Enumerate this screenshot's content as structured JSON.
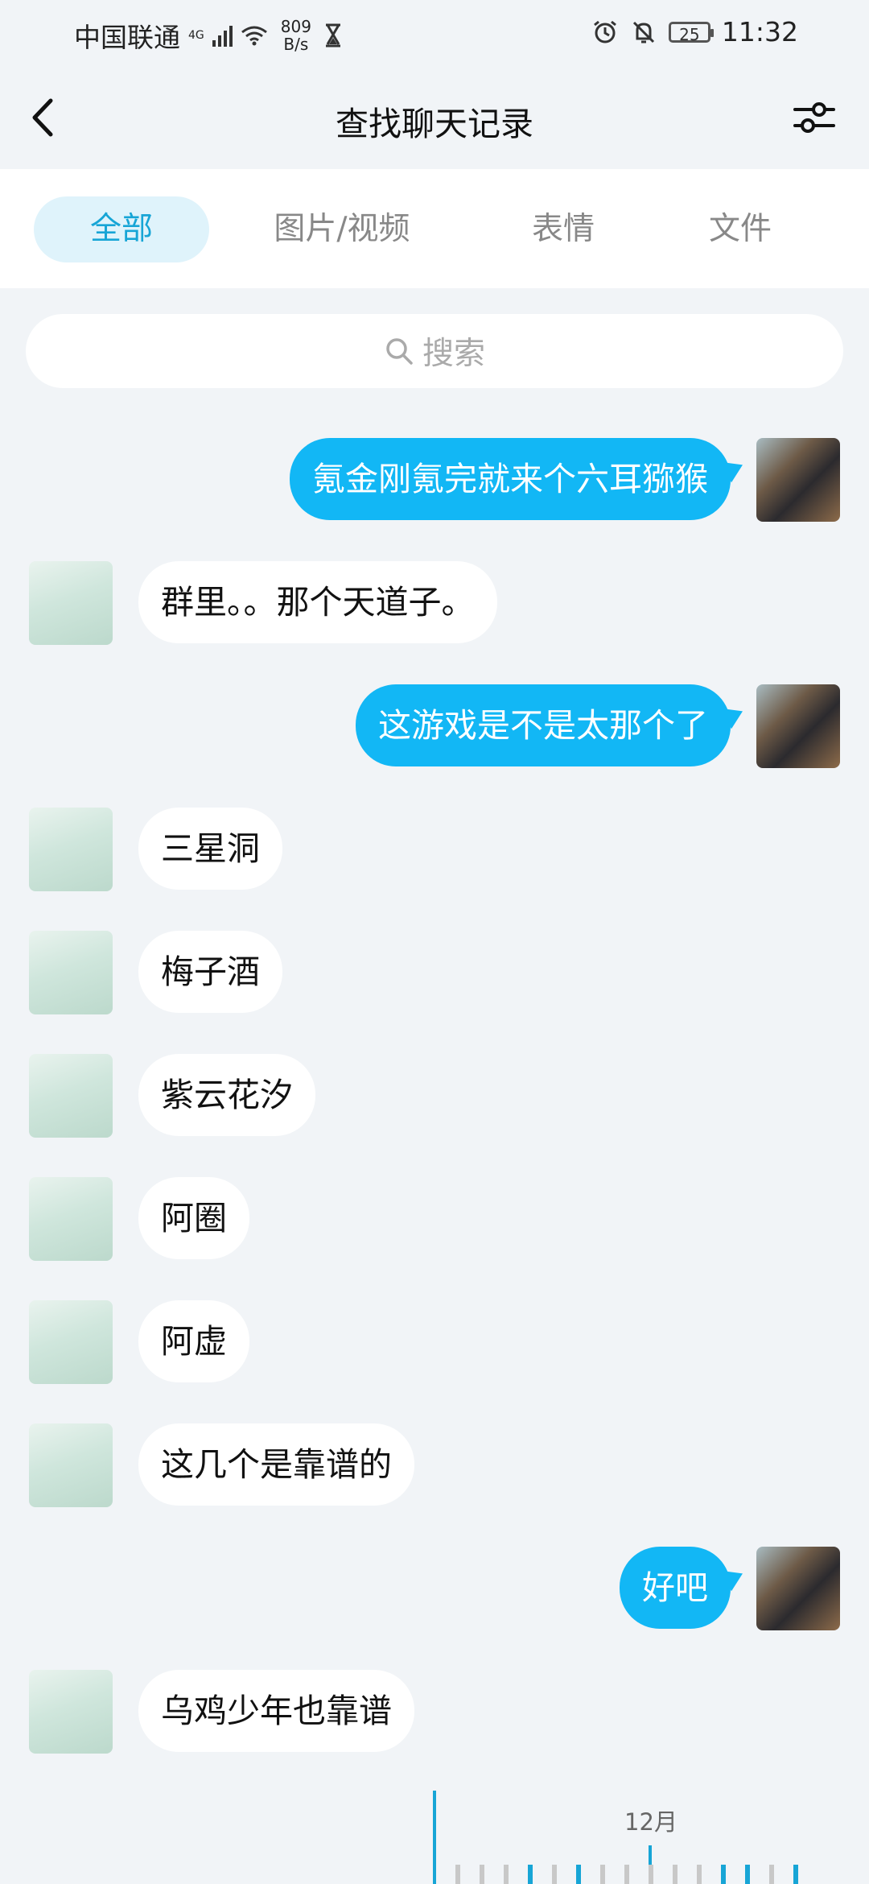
{
  "status_bar": {
    "carrier": "中国联通",
    "network": "4G",
    "speed_value": "809",
    "speed_unit": "B/s",
    "battery": "25",
    "time": "11:32"
  },
  "header": {
    "title": "查找聊天记录"
  },
  "tabs": [
    {
      "label": "全部",
      "active": true
    },
    {
      "label": "图片/视频",
      "active": false
    },
    {
      "label": "表情",
      "active": false
    },
    {
      "label": "文件",
      "active": false
    }
  ],
  "search": {
    "placeholder": "搜索"
  },
  "messages": [
    {
      "side": "right",
      "text": "氪金刚氪完就来个六耳猕猴"
    },
    {
      "side": "left",
      "text": "群里。。那个天道子。"
    },
    {
      "side": "right",
      "text": "这游戏是不是太那个了"
    },
    {
      "side": "left",
      "text": "三星洞"
    },
    {
      "side": "left",
      "text": "梅子酒"
    },
    {
      "side": "left",
      "text": "紫云花汐"
    },
    {
      "side": "left",
      "text": "阿圈"
    },
    {
      "side": "left",
      "text": "阿虚"
    },
    {
      "side": "left",
      "text": "这几个是靠谱的"
    },
    {
      "side": "right",
      "text": "好吧"
    },
    {
      "side": "left",
      "text": "乌鸡少年也靠谱"
    }
  ],
  "timeline": {
    "month_label": "12月"
  },
  "colors": {
    "accent": "#17a5d6",
    "outgoing_bubble": "#12b7f5",
    "incoming_bubble": "#ffffff",
    "background": "#f1f4f7"
  }
}
